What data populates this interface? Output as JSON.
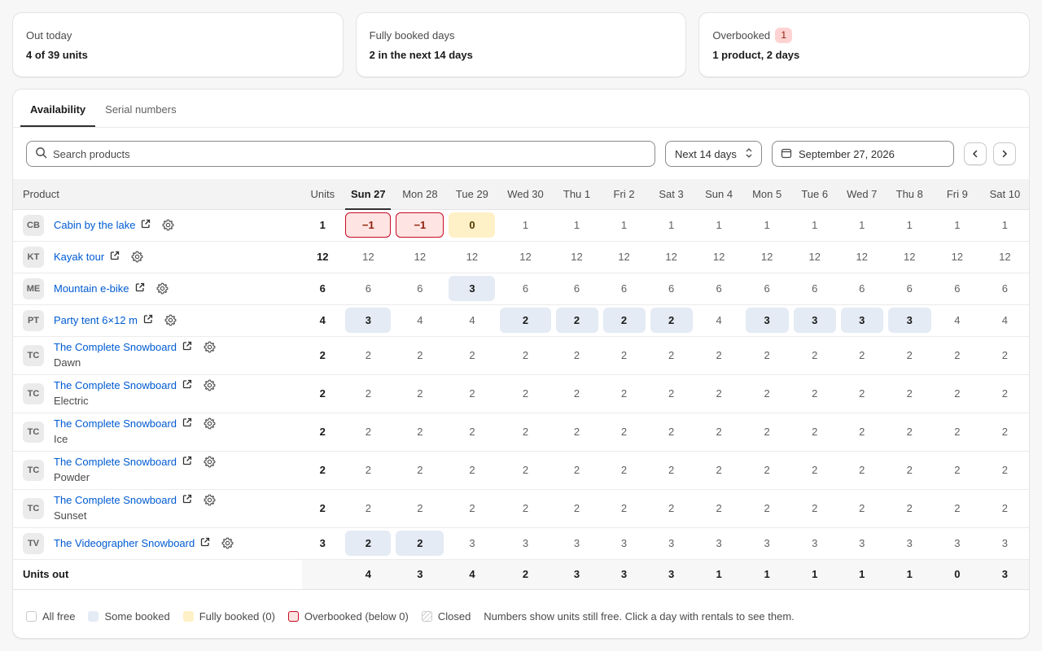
{
  "summary": {
    "out_today": {
      "label": "Out today",
      "value": "4 of 39 units"
    },
    "fully_booked": {
      "label": "Fully booked days",
      "value": "2 in the next 14 days"
    },
    "overbooked": {
      "label": "Overbooked",
      "badge": "1",
      "value": "1 product, 2 days"
    }
  },
  "tabs": [
    {
      "label": "Availability",
      "active": true
    },
    {
      "label": "Serial numbers",
      "active": false
    }
  ],
  "toolbar": {
    "search_placeholder": "Search products",
    "range": "Next 14 days",
    "date": "September 27, 2026"
  },
  "table": {
    "product_header": "Product",
    "units_header": "Units",
    "days": [
      "Sun 27",
      "Mon 28",
      "Tue 29",
      "Wed 30",
      "Thu 1",
      "Fri 2",
      "Sat 3",
      "Sun 4",
      "Mon 5",
      "Tue 6",
      "Wed 7",
      "Thu 8",
      "Fri 9",
      "Sat 10"
    ],
    "today_index": 0,
    "rows": [
      {
        "initials": "CB",
        "name": "Cabin by the lake",
        "variant": "",
        "units": "1",
        "days": [
          [
            "−1",
            "over"
          ],
          [
            "−1",
            "over"
          ],
          [
            "0",
            "full"
          ],
          [
            "1",
            ""
          ],
          [
            "1",
            ""
          ],
          [
            "1",
            ""
          ],
          [
            "1",
            ""
          ],
          [
            "1",
            ""
          ],
          [
            "1",
            ""
          ],
          [
            "1",
            ""
          ],
          [
            "1",
            ""
          ],
          [
            "1",
            ""
          ],
          [
            "1",
            ""
          ],
          [
            "1",
            ""
          ]
        ]
      },
      {
        "initials": "KT",
        "name": "Kayak tour",
        "variant": "",
        "units": "12",
        "days": [
          [
            "12",
            ""
          ],
          [
            "12",
            ""
          ],
          [
            "12",
            ""
          ],
          [
            "12",
            ""
          ],
          [
            "12",
            ""
          ],
          [
            "12",
            ""
          ],
          [
            "12",
            ""
          ],
          [
            "12",
            ""
          ],
          [
            "12",
            ""
          ],
          [
            "12",
            ""
          ],
          [
            "12",
            ""
          ],
          [
            "12",
            ""
          ],
          [
            "12",
            ""
          ],
          [
            "12",
            ""
          ]
        ]
      },
      {
        "initials": "ME",
        "name": "Mountain e-bike",
        "variant": "",
        "units": "6",
        "days": [
          [
            "6",
            ""
          ],
          [
            "6",
            ""
          ],
          [
            "3",
            "some"
          ],
          [
            "6",
            ""
          ],
          [
            "6",
            ""
          ],
          [
            "6",
            ""
          ],
          [
            "6",
            ""
          ],
          [
            "6",
            ""
          ],
          [
            "6",
            ""
          ],
          [
            "6",
            ""
          ],
          [
            "6",
            ""
          ],
          [
            "6",
            ""
          ],
          [
            "6",
            ""
          ],
          [
            "6",
            ""
          ]
        ]
      },
      {
        "initials": "PT",
        "name": "Party tent 6×12 m",
        "variant": "",
        "units": "4",
        "days": [
          [
            "3",
            "some"
          ],
          [
            "4",
            ""
          ],
          [
            "4",
            ""
          ],
          [
            "2",
            "some"
          ],
          [
            "2",
            "some"
          ],
          [
            "2",
            "some"
          ],
          [
            "2",
            "some"
          ],
          [
            "4",
            ""
          ],
          [
            "3",
            "some"
          ],
          [
            "3",
            "some"
          ],
          [
            "3",
            "some"
          ],
          [
            "3",
            "some"
          ],
          [
            "4",
            ""
          ],
          [
            "4",
            ""
          ]
        ]
      },
      {
        "initials": "TC",
        "name": "The Complete Snowboard",
        "variant": "Dawn",
        "units": "2",
        "days": [
          [
            "2",
            ""
          ],
          [
            "2",
            ""
          ],
          [
            "2",
            ""
          ],
          [
            "2",
            ""
          ],
          [
            "2",
            ""
          ],
          [
            "2",
            ""
          ],
          [
            "2",
            ""
          ],
          [
            "2",
            ""
          ],
          [
            "2",
            ""
          ],
          [
            "2",
            ""
          ],
          [
            "2",
            ""
          ],
          [
            "2",
            ""
          ],
          [
            "2",
            ""
          ],
          [
            "2",
            ""
          ]
        ]
      },
      {
        "initials": "TC",
        "name": "The Complete Snowboard",
        "variant": "Electric",
        "units": "2",
        "days": [
          [
            "2",
            ""
          ],
          [
            "2",
            ""
          ],
          [
            "2",
            ""
          ],
          [
            "2",
            ""
          ],
          [
            "2",
            ""
          ],
          [
            "2",
            ""
          ],
          [
            "2",
            ""
          ],
          [
            "2",
            ""
          ],
          [
            "2",
            ""
          ],
          [
            "2",
            ""
          ],
          [
            "2",
            ""
          ],
          [
            "2",
            ""
          ],
          [
            "2",
            ""
          ],
          [
            "2",
            ""
          ]
        ]
      },
      {
        "initials": "TC",
        "name": "The Complete Snowboard",
        "variant": "Ice",
        "units": "2",
        "days": [
          [
            "2",
            ""
          ],
          [
            "2",
            ""
          ],
          [
            "2",
            ""
          ],
          [
            "2",
            ""
          ],
          [
            "2",
            ""
          ],
          [
            "2",
            ""
          ],
          [
            "2",
            ""
          ],
          [
            "2",
            ""
          ],
          [
            "2",
            ""
          ],
          [
            "2",
            ""
          ],
          [
            "2",
            ""
          ],
          [
            "2",
            ""
          ],
          [
            "2",
            ""
          ],
          [
            "2",
            ""
          ]
        ]
      },
      {
        "initials": "TC",
        "name": "The Complete Snowboard",
        "variant": "Powder",
        "units": "2",
        "days": [
          [
            "2",
            ""
          ],
          [
            "2",
            ""
          ],
          [
            "2",
            ""
          ],
          [
            "2",
            ""
          ],
          [
            "2",
            ""
          ],
          [
            "2",
            ""
          ],
          [
            "2",
            ""
          ],
          [
            "2",
            ""
          ],
          [
            "2",
            ""
          ],
          [
            "2",
            ""
          ],
          [
            "2",
            ""
          ],
          [
            "2",
            ""
          ],
          [
            "2",
            ""
          ],
          [
            "2",
            ""
          ]
        ]
      },
      {
        "initials": "TC",
        "name": "The Complete Snowboard",
        "variant": "Sunset",
        "units": "2",
        "days": [
          [
            "2",
            ""
          ],
          [
            "2",
            ""
          ],
          [
            "2",
            ""
          ],
          [
            "2",
            ""
          ],
          [
            "2",
            ""
          ],
          [
            "2",
            ""
          ],
          [
            "2",
            ""
          ],
          [
            "2",
            ""
          ],
          [
            "2",
            ""
          ],
          [
            "2",
            ""
          ],
          [
            "2",
            ""
          ],
          [
            "2",
            ""
          ],
          [
            "2",
            ""
          ],
          [
            "2",
            ""
          ]
        ]
      },
      {
        "initials": "TV",
        "name": "The Videographer Snowboard",
        "variant": "",
        "units": "3",
        "days": [
          [
            "2",
            "some"
          ],
          [
            "2",
            "some"
          ],
          [
            "3",
            ""
          ],
          [
            "3",
            ""
          ],
          [
            "3",
            ""
          ],
          [
            "3",
            ""
          ],
          [
            "3",
            ""
          ],
          [
            "3",
            ""
          ],
          [
            "3",
            ""
          ],
          [
            "3",
            ""
          ],
          [
            "3",
            ""
          ],
          [
            "3",
            ""
          ],
          [
            "3",
            ""
          ],
          [
            "3",
            ""
          ]
        ]
      }
    ],
    "totals_label": "Units out",
    "totals": [
      "4",
      "3",
      "4",
      "2",
      "3",
      "3",
      "3",
      "1",
      "1",
      "1",
      "1",
      "1",
      "0",
      "3"
    ]
  },
  "legend": {
    "all_free": "All free",
    "some_booked": "Some booked",
    "fully_booked": "Fully booked (0)",
    "overbooked": "Overbooked (below 0)",
    "closed": "Closed",
    "note": "Numbers show units still free. Click a day with rentals to see them."
  },
  "colors": {
    "link": "#005bd3",
    "some_booked": "#e4ebf5",
    "fully_booked": "#fff1c7",
    "overbooked_bg": "#fee4e2",
    "overbooked_border": "#c70a24"
  }
}
